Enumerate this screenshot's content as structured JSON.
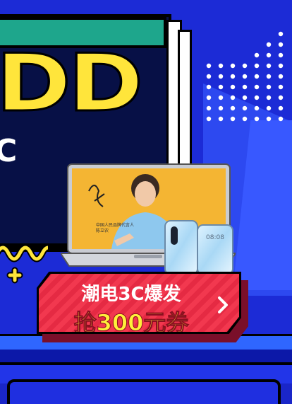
{
  "banner": {
    "big_number": "DD",
    "side_char": "C",
    "promo": {
      "line1": "潮电3C爆发",
      "line2": "抢300元券"
    },
    "laptop_screen_caption": "中国人民品牌代言人\n陈立农",
    "phone_time": "08:08"
  },
  "colors": {
    "background": "#1c2bd6",
    "accent_yellow": "#ffe53b",
    "promo_red": "#f2384f",
    "teal": "#1ea68c"
  },
  "icons": {
    "next": "chevron-right-icon",
    "decor_1": "squiggle-icon",
    "decor_2": "cross-icon"
  }
}
